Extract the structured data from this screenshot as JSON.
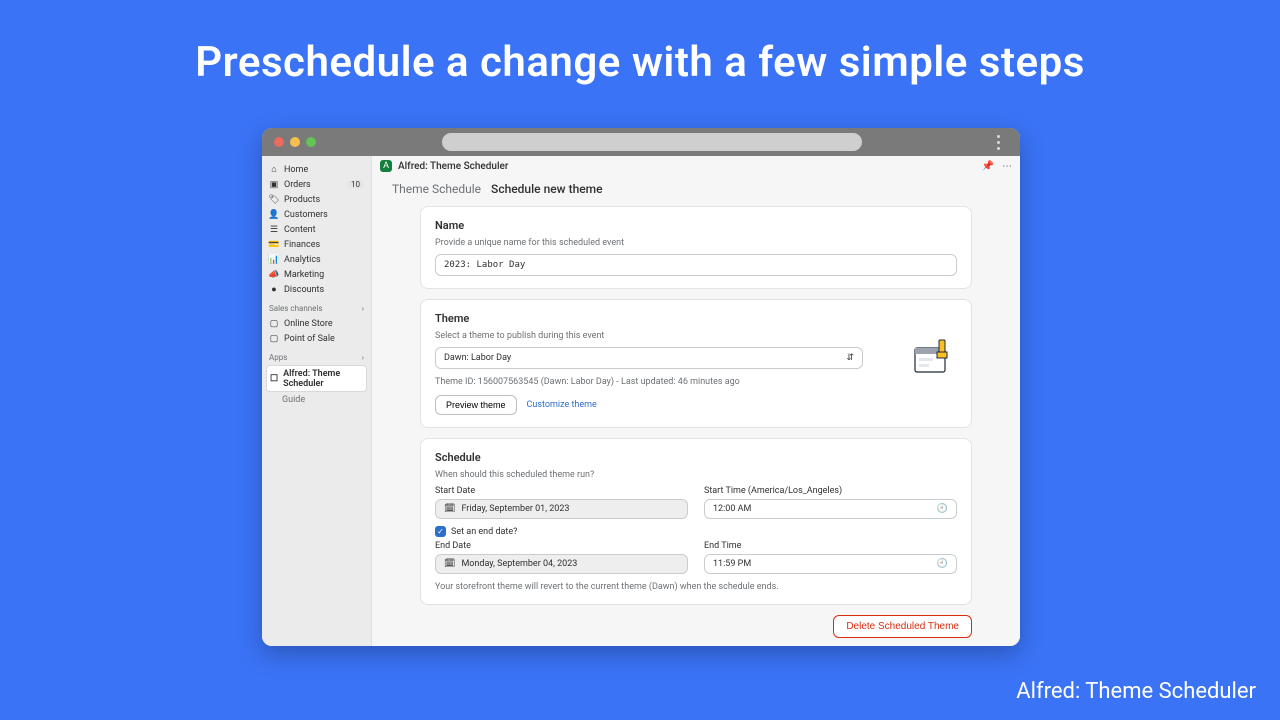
{
  "headline": "Preschedule a change with a few simple steps",
  "footer_label": "Alfred: Theme Scheduler",
  "sidebar": {
    "items": [
      {
        "icon": "⌂",
        "label": "Home"
      },
      {
        "icon": "▣",
        "label": "Orders",
        "badge": "10"
      },
      {
        "icon": "🏷",
        "label": "Products"
      },
      {
        "icon": "👤",
        "label": "Customers"
      },
      {
        "icon": "☰",
        "label": "Content"
      },
      {
        "icon": "💳",
        "label": "Finances"
      },
      {
        "icon": "📊",
        "label": "Analytics"
      },
      {
        "icon": "📣",
        "label": "Marketing"
      },
      {
        "icon": "●",
        "label": "Discounts"
      }
    ],
    "sales_section": "Sales channels",
    "sales": [
      {
        "icon": "▢",
        "label": "Online Store"
      },
      {
        "icon": "▢",
        "label": "Point of Sale"
      }
    ],
    "apps_section": "Apps",
    "apps": [
      {
        "icon": "☐",
        "label": "Alfred: Theme Scheduler",
        "active": true
      },
      {
        "icon": "",
        "label": "Guide"
      }
    ]
  },
  "app_header": {
    "title": "Alfred: Theme Scheduler"
  },
  "breadcrumb": {
    "parent": "Theme Schedule",
    "current": "Schedule new theme"
  },
  "name_card": {
    "title": "Name",
    "sub": "Provide a unique name for this scheduled event",
    "value": "2023: Labor Day"
  },
  "theme_card": {
    "title": "Theme",
    "sub": "Select a theme to publish during this event",
    "selected": "Dawn: Labor Day",
    "meta": "Theme ID: 156007563545 (Dawn: Labor Day) - Last updated: 46 minutes ago",
    "preview_btn": "Preview theme",
    "customize_link": "Customize theme"
  },
  "schedule_card": {
    "title": "Schedule",
    "sub": "When should this scheduled theme run?",
    "start_date_label": "Start Date",
    "start_date_value": "Friday, September 01, 2023",
    "start_time_label": "Start Time (America/Los_Angeles)",
    "start_time_value": "12:00 AM",
    "end_checkbox": "Set an end date?",
    "end_date_label": "End Date",
    "end_date_value": "Monday, September 04, 2023",
    "end_time_label": "End Time",
    "end_time_value": "11:59 PM",
    "footer_note": "Your storefront theme will revert to the current theme (Dawn) when the schedule ends."
  },
  "delete_btn": "Delete Scheduled Theme"
}
